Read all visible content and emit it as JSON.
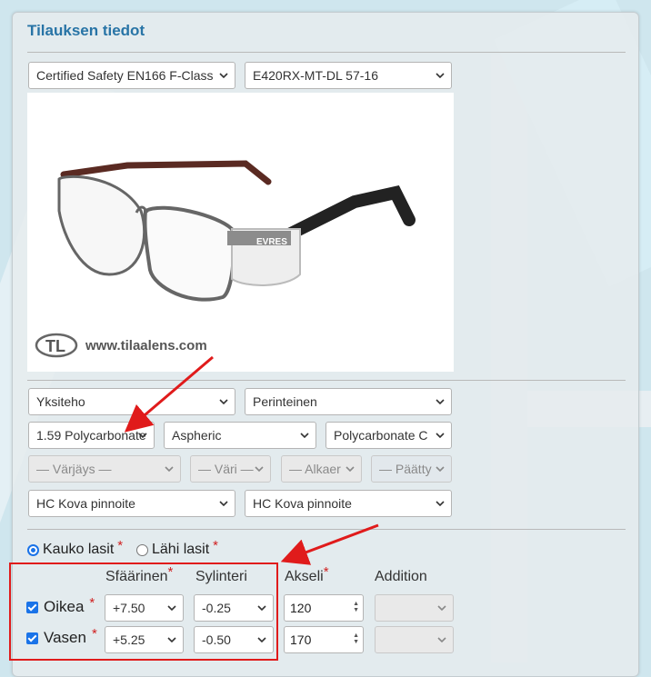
{
  "section_title": "Tilauksen tiedot",
  "frame": {
    "brand_select": "Certified Safety EN166 F-Class",
    "model_select": "E420RX-MT-DL 57-16"
  },
  "photo": {
    "watermark_text": "www.tilaalens.com",
    "frame_print": "EVRES"
  },
  "lens": {
    "type": "Yksiteho",
    "design": "Perinteinen",
    "material": "1.59 Polycarbonate",
    "surface": "Aspheric",
    "coating_variant": "Polycarbonate C",
    "tint": "— Värjäys —",
    "color": "— Väri —",
    "start": "— Alkaer",
    "end": "— Päätty",
    "hard_coat_1": "HC Kova pinnoite",
    "hard_coat_2": "HC Kova pinnoite"
  },
  "vision": {
    "distance_label": "Kauko lasit",
    "near_label": "Lähi lasit",
    "required_mark": "*"
  },
  "prescription": {
    "headers": {
      "sphere": "Sfäärinen",
      "cylinder": "Sylinteri",
      "axis": "Akseli",
      "addition": "Addition"
    },
    "right": {
      "label": "Oikea",
      "sphere": "+7.50",
      "cylinder": "-0.25",
      "axis": "120",
      "addition": ""
    },
    "left": {
      "label": "Vasen",
      "sphere": "+5.25",
      "cylinder": "-0.50",
      "axis": "170",
      "addition": ""
    }
  },
  "colors": {
    "accent": "#1a73e8",
    "title": "#2874a6",
    "annotation": "#e01b1b"
  }
}
